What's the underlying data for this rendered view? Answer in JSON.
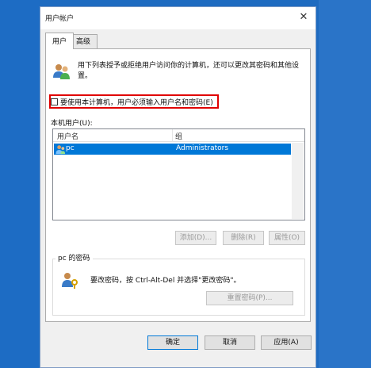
{
  "window": {
    "title": "用户帐户",
    "close_glyph": "✕"
  },
  "tabs": [
    {
      "label": "用户"
    },
    {
      "label": "高级"
    }
  ],
  "intro": {
    "text": "用下列表授予或拒绝用户访问你的计算机，还可以更改其密码和其他设置。"
  },
  "require_login": {
    "label": "要使用本计算机，用户必须输入用户名和密码(E)",
    "checked": false
  },
  "users": {
    "label": "本机用户(U):",
    "columns": [
      "用户名",
      "组"
    ],
    "rows": [
      {
        "name": "pc",
        "group": "Administrators"
      }
    ]
  },
  "user_buttons": {
    "add": "添加(D)...",
    "remove": "删除(R)",
    "properties": "属性(O)"
  },
  "password": {
    "group_title": "pc 的密码",
    "text": "要改密码，按 Ctrl-Alt-Del 并选择\"更改密码\"。",
    "reset": "重置密码(P)..."
  },
  "footer": {
    "ok": "确定",
    "cancel": "取消",
    "apply": "应用(A)"
  },
  "colors": {
    "desktop": "#1e6bc0",
    "selection": "#0078d7",
    "highlight_box": "#e00000"
  },
  "icons": [
    "users-icon",
    "user-icon",
    "user-key-icon",
    "close-icon"
  ]
}
